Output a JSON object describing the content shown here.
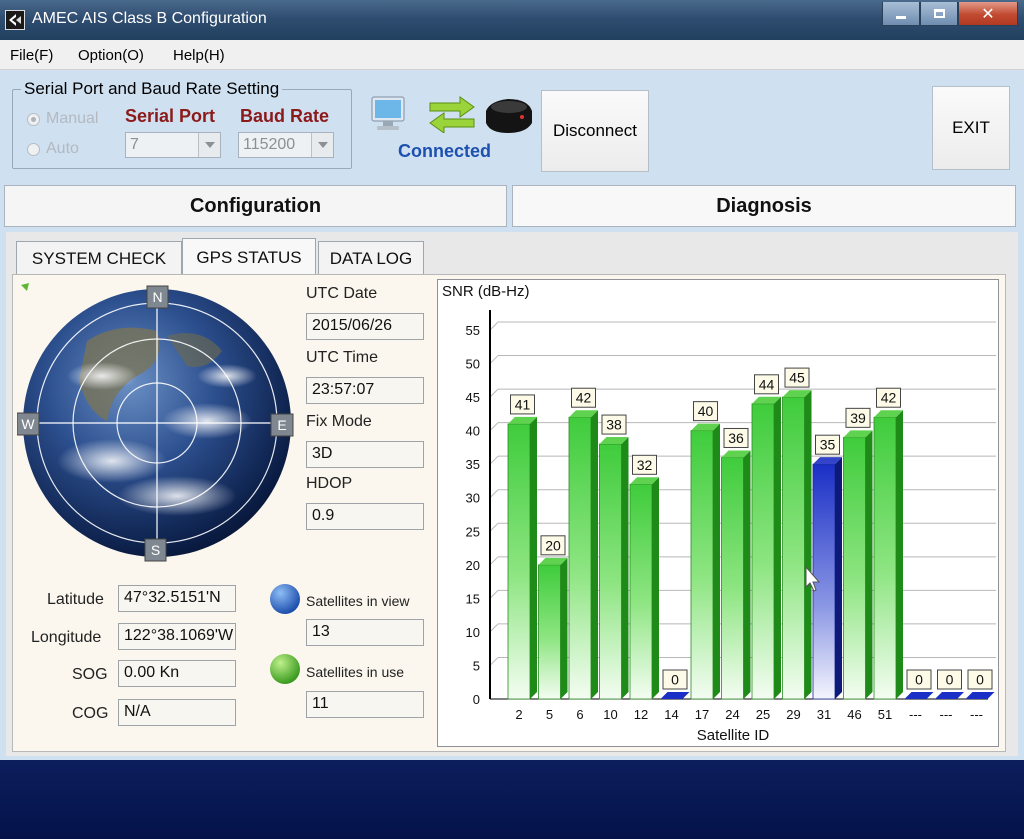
{
  "window": {
    "title": "AMEC AIS Class B Configuration",
    "controls": {
      "minimize": "",
      "maximize": "",
      "close": "✕"
    }
  },
  "menu": [
    "File(F)",
    "Option(O)",
    "Help(H)"
  ],
  "serial": {
    "legend": "Serial Port and Baud Rate Setting",
    "mode_manual": "Manual",
    "mode_auto": "Auto",
    "port_label": "Serial Port",
    "port_value": "7",
    "baud_label": "Baud Rate",
    "baud_value": "115200"
  },
  "connection": {
    "status": "Connected",
    "disconnect_label": "Disconnect",
    "exit_label": "EXIT"
  },
  "main_tabs": [
    "Configuration",
    "Diagnosis"
  ],
  "sub_tabs": [
    "SYSTEM CHECK",
    "GPS STATUS",
    "DATA LOG"
  ],
  "globe": {
    "north": "N",
    "south": "S",
    "east": "E",
    "west": "W"
  },
  "gps": {
    "utc_date_label": "UTC Date",
    "utc_date": "2015/06/26",
    "utc_time_label": "UTC Time",
    "utc_time": "23:57:07",
    "fix_mode_label": "Fix Mode",
    "fix_mode": "3D",
    "hdop_label": "HDOP",
    "hdop": "0.9",
    "latitude_label": "Latitude",
    "latitude": "47°32.5151'N",
    "longitude_label": "Longitude",
    "longitude": "122°38.1069'W",
    "sog_label": "SOG",
    "sog": "0.00 Kn",
    "cog_label": "COG",
    "cog": "N/A",
    "in_view_label": "Satellites in view",
    "in_view": "13",
    "in_use_label": "Satellites in use",
    "in_use": "11"
  },
  "colors": {
    "in_view": "#2a66c8",
    "in_use": "#55c23a",
    "bar_green": "#3cc83a",
    "bar_blue": "#1d2fc0",
    "status_bar": "#0a1a55"
  },
  "chart_data": {
    "type": "bar",
    "ylabel": "SNR (dB-Hz)",
    "xlabel": "Satellite ID",
    "ylim": [
      0,
      55
    ],
    "yticks": [
      0,
      5,
      10,
      15,
      20,
      25,
      30,
      35,
      40,
      45,
      50,
      55
    ],
    "categories": [
      "2",
      "5",
      "6",
      "10",
      "12",
      "14",
      "17",
      "24",
      "25",
      "29",
      "31",
      "46",
      "51",
      "---",
      "---",
      "---"
    ],
    "values": [
      41,
      20,
      42,
      38,
      32,
      0,
      40,
      36,
      44,
      45,
      35,
      39,
      42,
      0,
      0,
      0
    ],
    "in_use": [
      true,
      true,
      true,
      true,
      true,
      false,
      true,
      true,
      true,
      true,
      false,
      true,
      true,
      false,
      false,
      false
    ],
    "grid": true
  }
}
